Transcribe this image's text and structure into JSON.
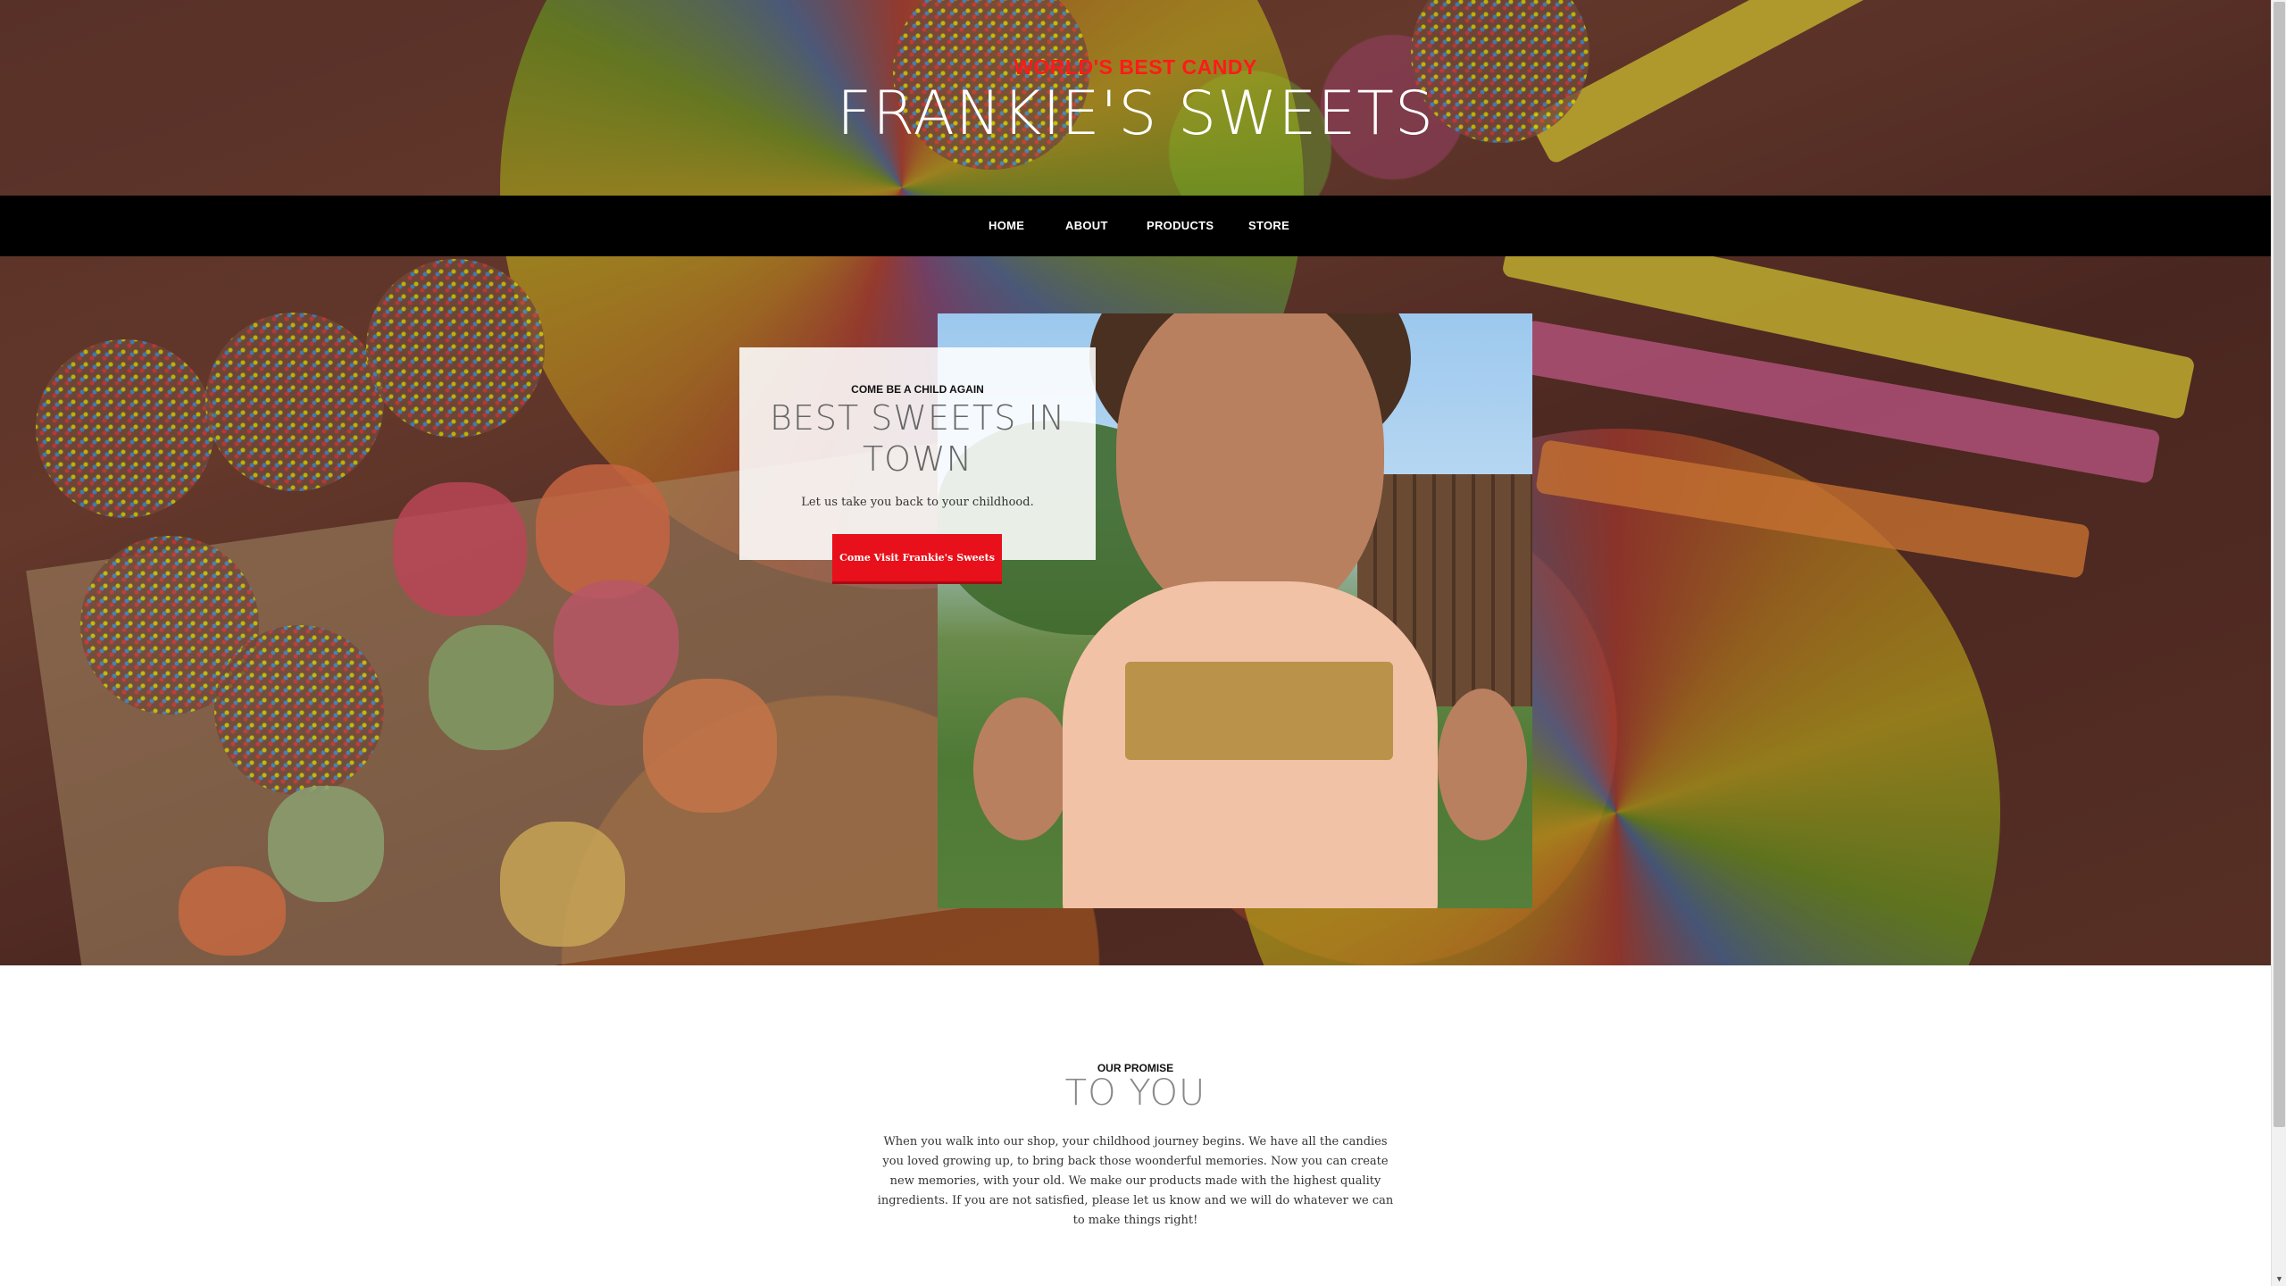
{
  "header": {
    "tagline": "WORLD'S BEST CANDY",
    "site_title": "FRANKIE'S SWEETS"
  },
  "nav": {
    "items": [
      {
        "label": "HOME"
      },
      {
        "label": "ABOUT"
      },
      {
        "label": "PRODUCTS"
      },
      {
        "label": "STORE"
      }
    ]
  },
  "intro": {
    "eyebrow": "COME BE A CHILD AGAIN",
    "title": "BEST SWEETS IN TOWN",
    "text": "Let us take you back to your childhood.",
    "cta_label": "Come Visit Frankie's Sweets"
  },
  "promise": {
    "eyebrow": "OUR PROMISE",
    "title": "TO YOU",
    "text": "When you walk into our shop, your childhood journey begins. We have all the candies you loved growing up, to bring back those woonderful memories. Now you can create new memories, with your old. We make our products made with the highest quality ingredients. If you are not satisfied, please let us know and we will do whatever we can to make things right!"
  },
  "colors": {
    "accent": "#ff1a1a",
    "button": "#e8101a",
    "nav_bg": "#000000"
  },
  "icons": {
    "scroll_down": "chevron-down-icon"
  }
}
